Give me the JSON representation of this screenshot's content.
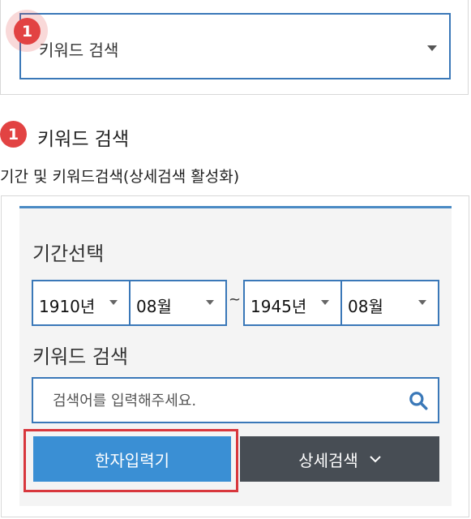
{
  "top": {
    "marker_number": "1",
    "select_label": "키워드 검색"
  },
  "section": {
    "marker_number": "1",
    "heading": "키워드 검색",
    "description": "기간 및 키워드검색(상세검색 활성화)"
  },
  "form": {
    "period_label": "기간선택",
    "start": {
      "year": "1910년",
      "month": "08월"
    },
    "separator": "~",
    "end": {
      "year": "1945년",
      "month": "08월"
    },
    "keyword_label": "키워드 검색",
    "search": {
      "placeholder": "검색어를 입력해주세요.",
      "value": ""
    },
    "hanja_button": "한자입력기",
    "detail_button": "상세검색"
  },
  "colors": {
    "accent_blue": "#3a78b8",
    "button_blue": "#3a8fd4",
    "button_dark": "#474d54",
    "marker_red": "#e24343",
    "highlight_red": "#d8373d"
  },
  "icons": {
    "dropdown": "caret-down-icon",
    "search": "search-icon",
    "detail": "chevron-down-icon"
  }
}
